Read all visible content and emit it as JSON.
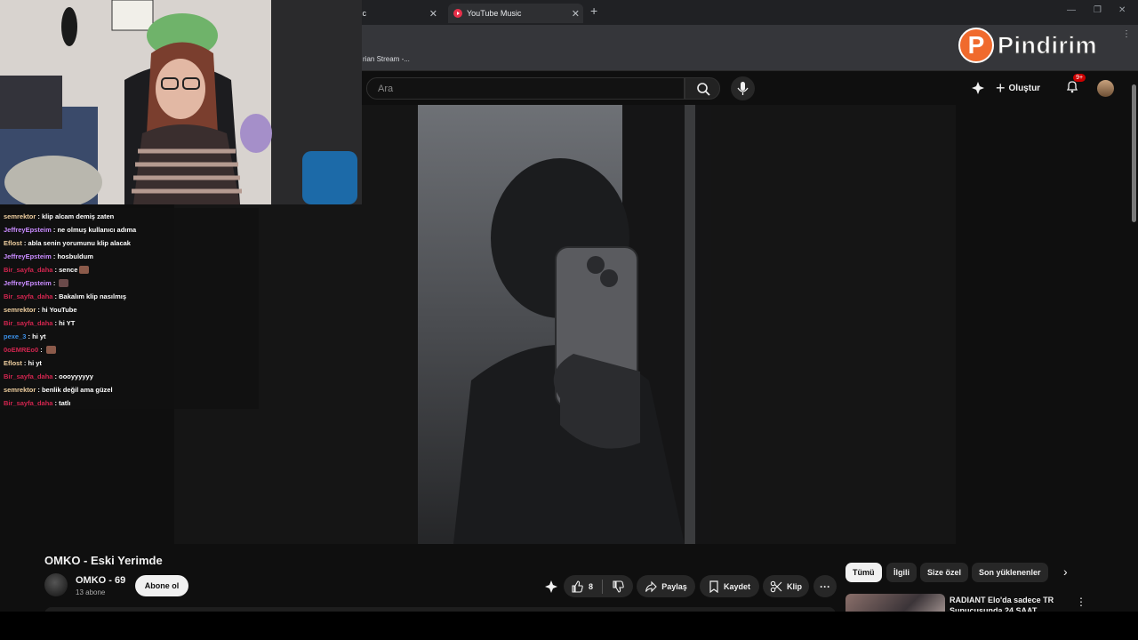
{
  "browser": {
    "tabs": [
      {
        "title": "usic"
      },
      {
        "title": "YouTube Music"
      }
    ],
    "bookmark": "rian Stream -..."
  },
  "youtube": {
    "search_placeholder": "Ara",
    "create_label": "Oluştur",
    "notification_badge": "9+",
    "video": {
      "title": "OMKO - Eski Yerimde",
      "channel": "OMKO - 69",
      "subscribers": "13 abone",
      "subscribe_label": "Abone ol",
      "like_count": "8",
      "share_label": "Paylaş",
      "save_label": "Kaydet",
      "clip_label": "Klip"
    },
    "chips": [
      "Tümü",
      "İlgili",
      "Size özel",
      "Son yüklenenler"
    ],
    "recommendation": {
      "title": "RADIANT Elo'da sadece TR Sunucusunda 24 SAAT"
    }
  },
  "chat": [
    {
      "user": "semrektor",
      "user_color": "#f0d0a0",
      "text": "klip alcam demiş zaten"
    },
    {
      "user": "JeffreyEpsteim",
      "user_color": "#c98bff",
      "text": "ne olmuş kullanıcı adıma"
    },
    {
      "user": "Eflost",
      "user_color": "#f0d0a0",
      "text": "abla senin yorumunu klip alacak"
    },
    {
      "user": "JeffreyEpsteim",
      "user_color": "#c98bff",
      "text": "hosbuldum"
    },
    {
      "user": "Bir_sayfa_daha",
      "user_color": "#d2254f",
      "text": "sence"
    },
    {
      "user": "JeffreyEpsteim",
      "user_color": "#c98bff",
      "text": ""
    },
    {
      "user": "Bir_sayfa_daha",
      "user_color": "#d2254f",
      "text": "Bakalım klip nasılmış"
    },
    {
      "user": "semrektor",
      "user_color": "#f0d0a0",
      "text": "hi YouTube"
    },
    {
      "user": "Bir_sayfa_daha",
      "user_color": "#d2254f",
      "text": "hi YT"
    },
    {
      "user": "pexe_3",
      "user_color": "#3a8ee6",
      "text": "hi yt"
    },
    {
      "user": "0oEMREo0",
      "user_color": "#d2254f",
      "text": ""
    },
    {
      "user": "Eflost",
      "user_color": "#f0d0a0",
      "text": "hi yt"
    },
    {
      "user": "Bir_sayfa_daha",
      "user_color": "#d2254f",
      "text": "oooyyyyyy"
    },
    {
      "user": "semrektor",
      "user_color": "#f0d0a0",
      "text": "benlik değil ama güzel"
    },
    {
      "user": "Bir_sayfa_daha",
      "user_color": "#d2254f",
      "text": "tatlı"
    }
  ],
  "overlay_logo": {
    "letter": "P",
    "text": "Pindirim"
  }
}
